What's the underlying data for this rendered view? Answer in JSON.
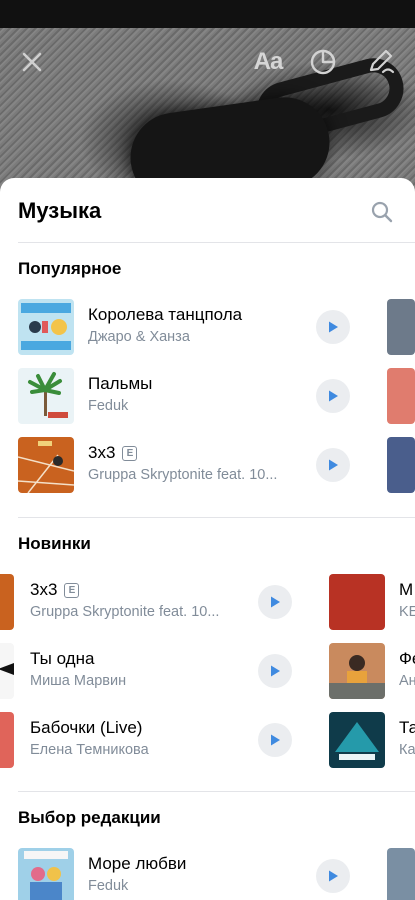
{
  "toolbar": {
    "text_tool_label": "Aa"
  },
  "sheet": {
    "title": "Музыка"
  },
  "sections": {
    "popular": {
      "title": "Популярное",
      "tracks": [
        {
          "title": "Королева танцпола",
          "artist": "Джаро & Ханза",
          "explicit": false
        },
        {
          "title": "Пальмы",
          "artist": "Feduk",
          "explicit": false
        },
        {
          "title": "3x3",
          "artist": "Gruppa Skryptonite feat. 10...",
          "explicit": true,
          "explicit_mark": "E"
        }
      ]
    },
    "new": {
      "title": "Новинки",
      "tracks": [
        {
          "title": "3x3",
          "artist": "Gruppa Skryptonite feat. 10...",
          "explicit": true,
          "explicit_mark": "E"
        },
        {
          "title": "Ты одна",
          "artist": "Миша Марвин",
          "explicit": false
        },
        {
          "title": "Бабочки (Live)",
          "artist": "Елена Темникова",
          "explicit": false
        }
      ],
      "next_column": [
        {
          "title": "М",
          "artist": "KE"
        },
        {
          "title": "Фе",
          "artist": "Ан"
        },
        {
          "title": "Та",
          "artist": "Ка"
        }
      ]
    },
    "editors": {
      "title": "Выбор редакции",
      "tracks": [
        {
          "title": "Море любви",
          "artist": "Feduk",
          "explicit": false
        }
      ]
    }
  },
  "colors": {
    "accent": "#3f8ae0",
    "secondary_text": "#818c99",
    "play_bg": "#ebedf0"
  }
}
